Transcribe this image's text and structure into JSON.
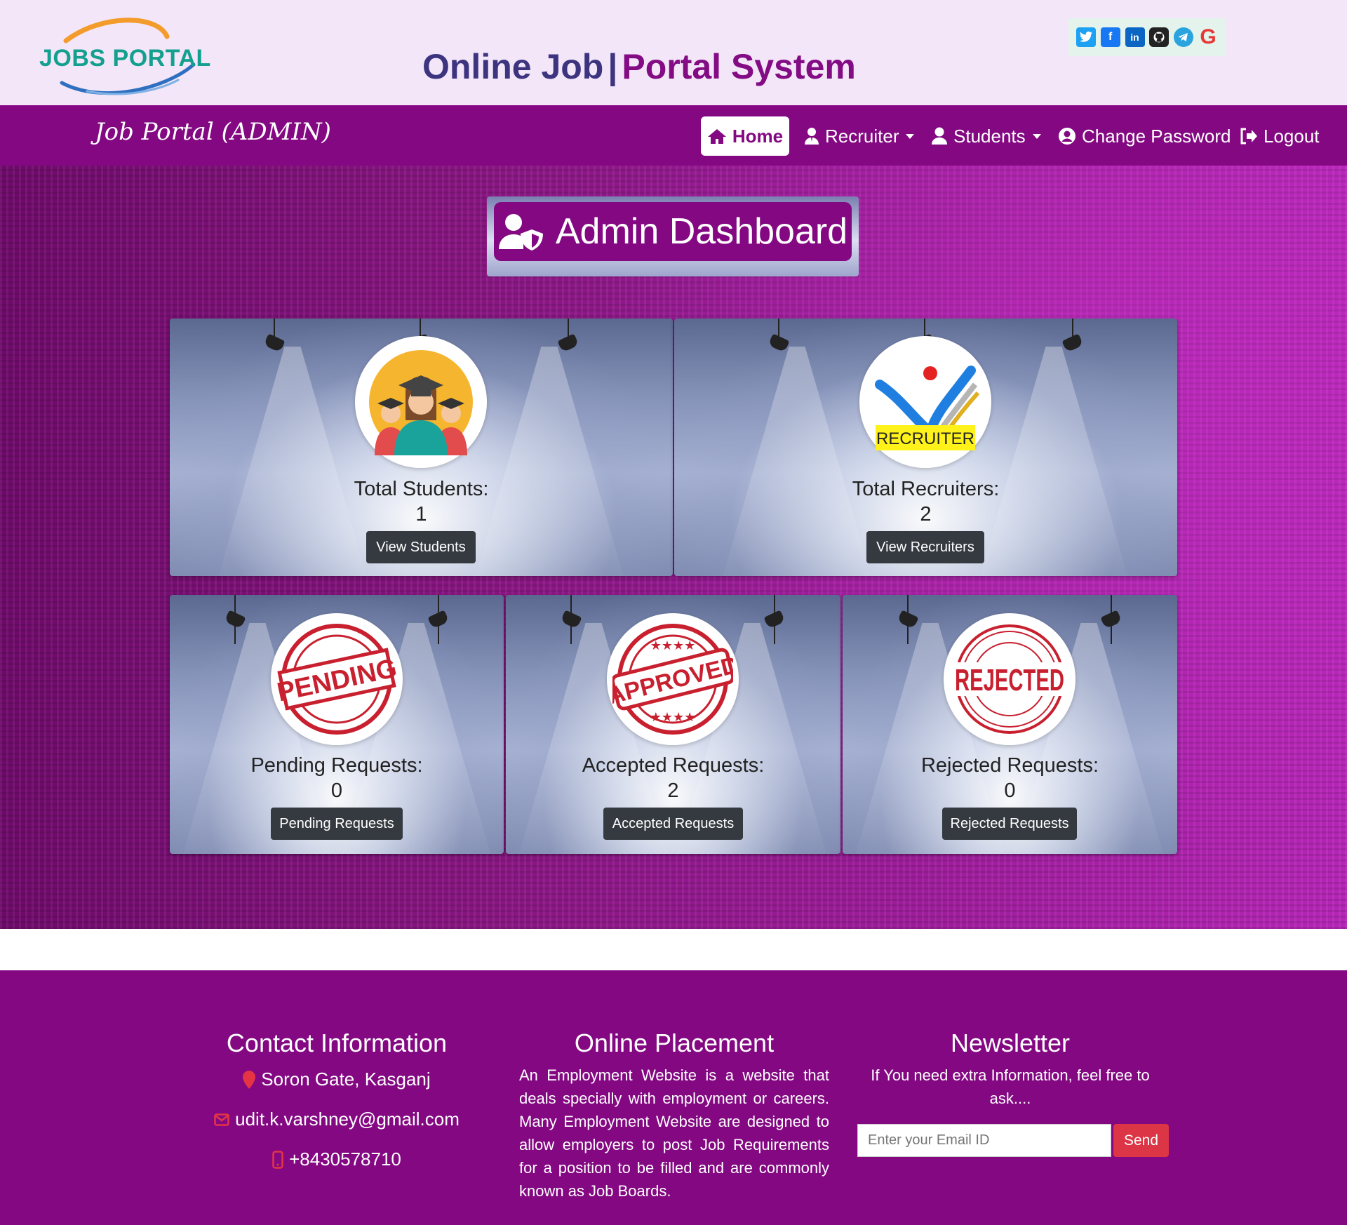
{
  "header": {
    "logo_text": "JOBS PORTAL",
    "title_part1": "Online Job",
    "title_separator": "|",
    "title_part2": "Portal System",
    "social_icons": [
      "twitter-icon",
      "facebook-icon",
      "linkedin-icon",
      "github-icon",
      "telegram-icon",
      "google-icon"
    ]
  },
  "navbar": {
    "brand": "Job Portal (ADMIN)",
    "items": [
      {
        "label": "Home",
        "icon": "home-icon",
        "active": true
      },
      {
        "label": "Recruiter",
        "icon": "user-tie-icon",
        "dropdown": true
      },
      {
        "label": "Students",
        "icon": "user-icon",
        "dropdown": true
      },
      {
        "label": "Change Password",
        "icon": "user-circle-icon"
      },
      {
        "label": "Logout",
        "icon": "sign-out-icon"
      }
    ]
  },
  "dashboard": {
    "title": "Admin Dashboard",
    "title_icon": "user-shield-icon",
    "cards": [
      {
        "label": "Total Students:",
        "count": "1",
        "button": "View Students",
        "image": "graduates-image"
      },
      {
        "label": "Total Recruiters:",
        "count": "2",
        "button": "View Recruiters",
        "image": "recruiter-image",
        "image_text": "RECRUITER"
      },
      {
        "label": "Pending Requests:",
        "count": "0",
        "button": "Pending Requests",
        "image": "pending-stamp",
        "image_text": "PENDING"
      },
      {
        "label": "Accepted Requests:",
        "count": "2",
        "button": "Accepted Requests",
        "image": "approved-stamp",
        "image_text": "APPROVED"
      },
      {
        "label": "Rejected Requests:",
        "count": "0",
        "button": "Rejected Requests",
        "image": "rejected-stamp",
        "image_text": "REJECTED"
      }
    ]
  },
  "footer": {
    "contact": {
      "title": "Contact Information",
      "address": "Soron Gate, Kasganj",
      "email": "udit.k.varshney@gmail.com",
      "phone": "+8430578710"
    },
    "placement": {
      "title": "Online Placement",
      "text": "An Employment Website is a website that deals specially with employment or careers. Many Employment Website are designed to allow employers to post Job Requirements for a position to be filled and are commonly known as Job Boards."
    },
    "newsletter": {
      "title": "Newsletter",
      "text": "If You need extra Information, feel free to ask....",
      "email_placeholder": "Enter your Email ID",
      "send_label": "Send"
    }
  },
  "colors": {
    "primary_purple": "#830882",
    "title_blue": "#3d3480",
    "header_bg": "#f3e6f8",
    "button_dark": "#343a40",
    "send_red": "#dc3545"
  }
}
